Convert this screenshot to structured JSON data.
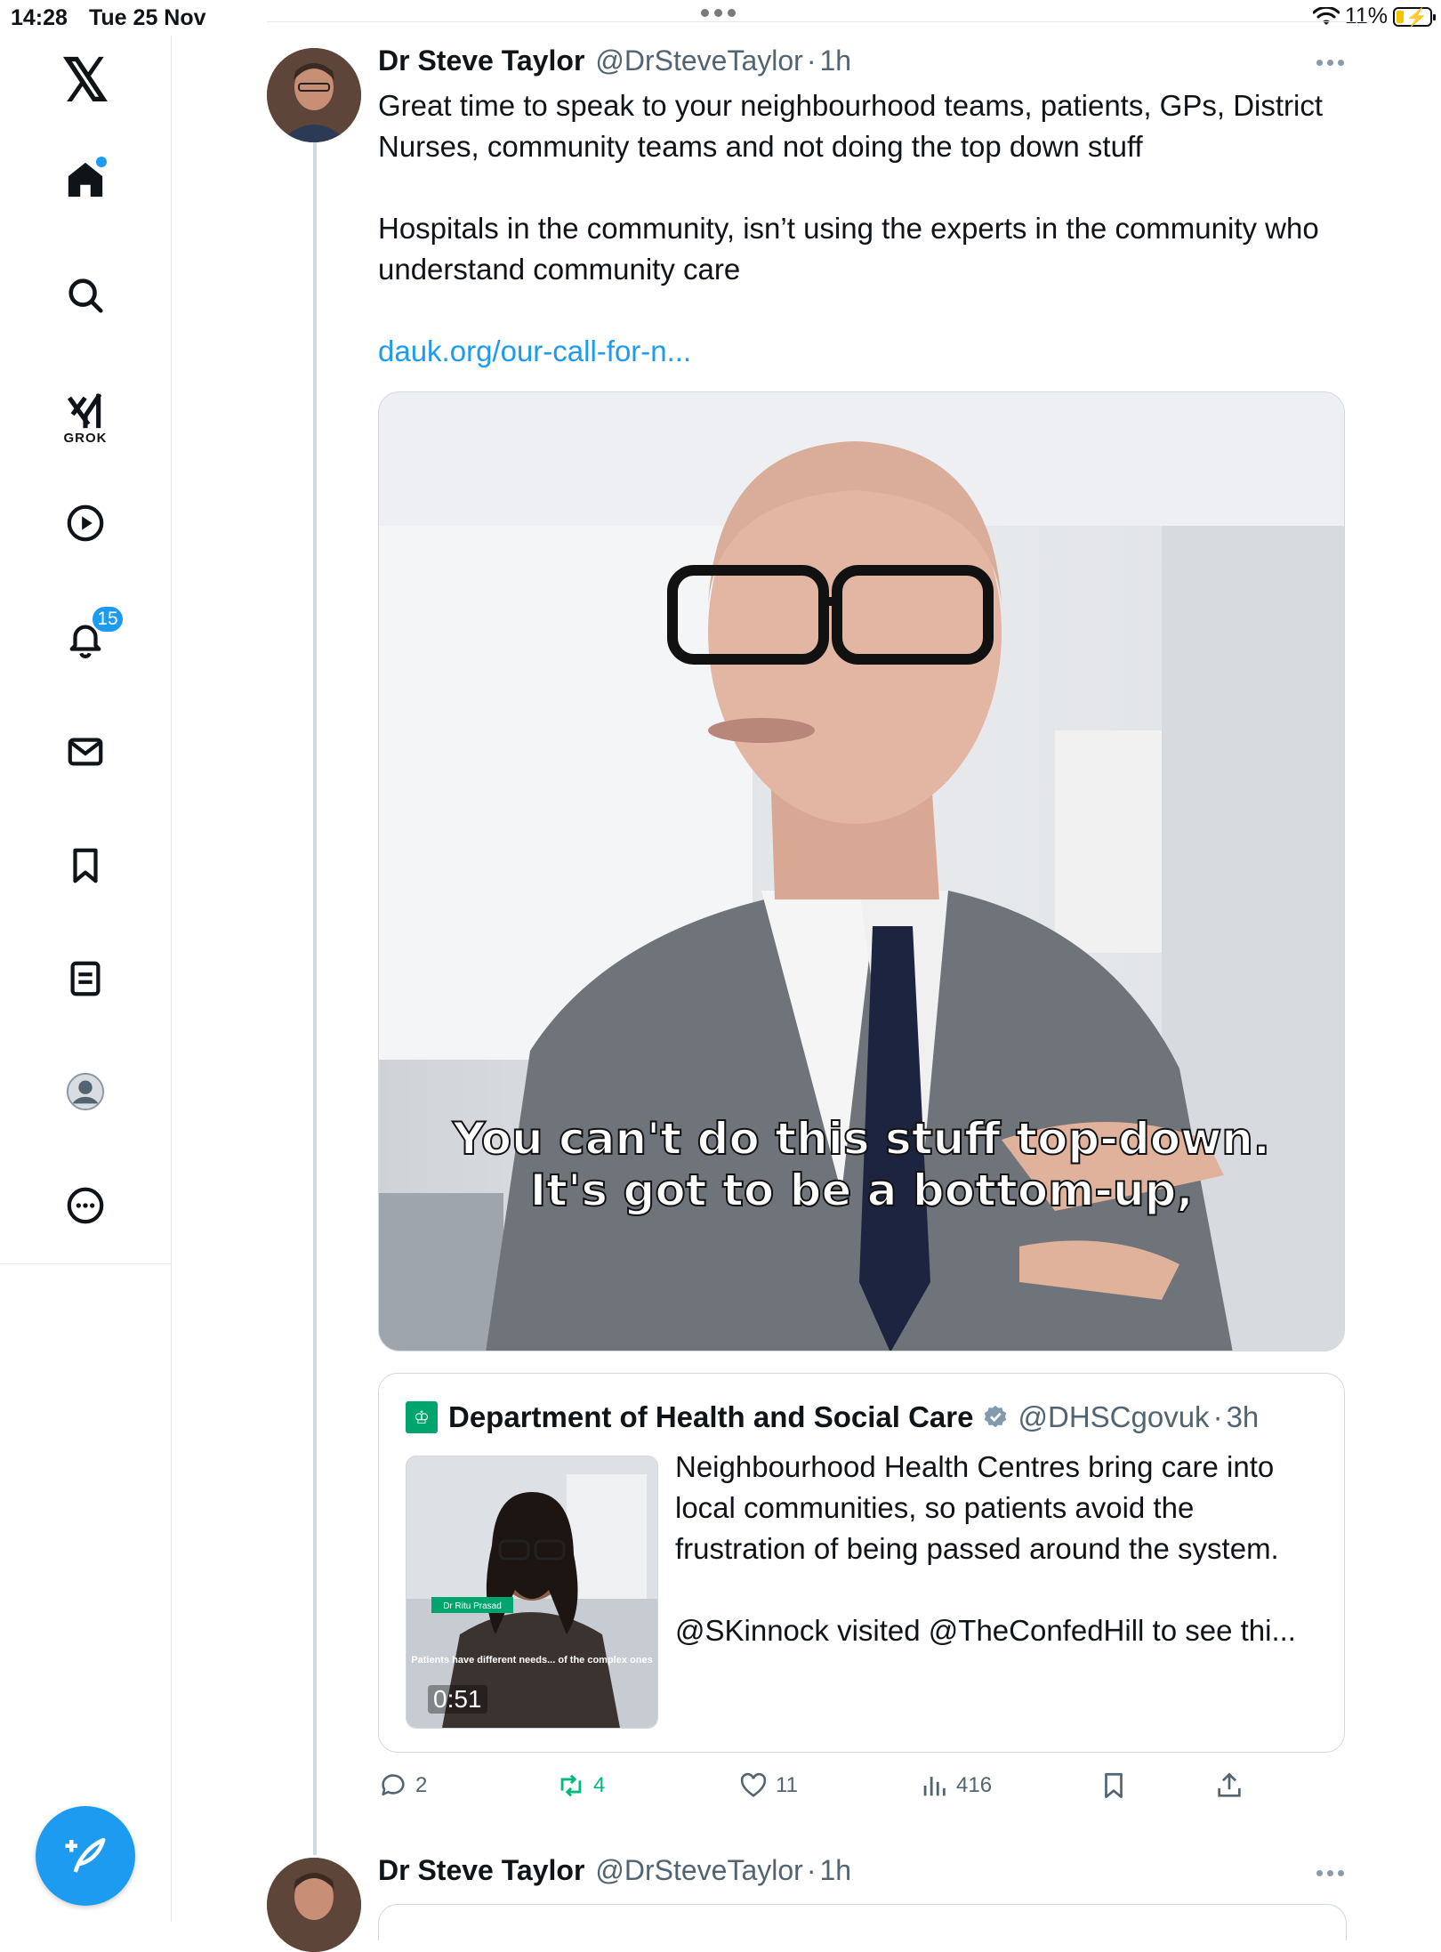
{
  "status_bar": {
    "time": "14:28",
    "date": "Tue 25 Nov",
    "battery": "11%"
  },
  "sidebar": {
    "items": [
      {
        "name": "x-logo",
        "icon": "x-logo-icon",
        "label": "𝕏"
      },
      {
        "name": "home",
        "icon": "home-icon"
      },
      {
        "name": "explore",
        "icon": "search-icon"
      },
      {
        "name": "grok",
        "icon": "grok-icon",
        "label": "GROK"
      },
      {
        "name": "video",
        "icon": "play-icon"
      },
      {
        "name": "notifications",
        "icon": "bell-icon",
        "badge": "15"
      },
      {
        "name": "messages",
        "icon": "mail-icon"
      },
      {
        "name": "bookmarks",
        "icon": "bookmark-icon"
      },
      {
        "name": "lists",
        "icon": "list-icon"
      },
      {
        "name": "profile",
        "icon": "avatar-icon"
      },
      {
        "name": "more",
        "icon": "more-circle-icon"
      }
    ],
    "compose_icon": "compose-feather-icon"
  },
  "tweet": {
    "author_name": "Dr Steve Taylor",
    "handle": "@DrSteveTaylor",
    "separator": "·",
    "time": "1h",
    "text_paragraphs": [
      "Great time to speak to your neighbourhood teams, patients, GPs, District Nurses, community teams and not doing the top down stuff",
      "Hospitals in the community, isn’t using the experts in the community who understand community care"
    ],
    "link": "dauk.org/our-call-for-n...",
    "media_caption": [
      "You can't do this stuff top-down.",
      "It's got to be a bottom-up,"
    ],
    "quote": {
      "author_name": "Department of Health and Social Care",
      "handle": "@DHSCgovuk",
      "separator": "·",
      "time": "3h",
      "text_paragraphs": [
        "Neighbourhood Health Centres bring care into local communities, so patients avoid the frustration of being passed around the system.",
        "@SKinnock visited @TheConfedHill to see thi..."
      ],
      "video_duration": "0:51",
      "thumb_name_tag": "Dr Ritu Prasad",
      "thumb_caption": "Patients have different needs... of the complex ones"
    },
    "actions": {
      "replies": "2",
      "reposts": "4",
      "likes": "11",
      "views": "416"
    },
    "colors": {
      "link": "#1d9bf0",
      "repost": "#00ba7c",
      "muted": "#536471"
    }
  },
  "tweet2": {
    "author_name": "Dr Steve Taylor",
    "handle": "@DrSteveTaylor",
    "separator": "·",
    "time": "1h"
  }
}
